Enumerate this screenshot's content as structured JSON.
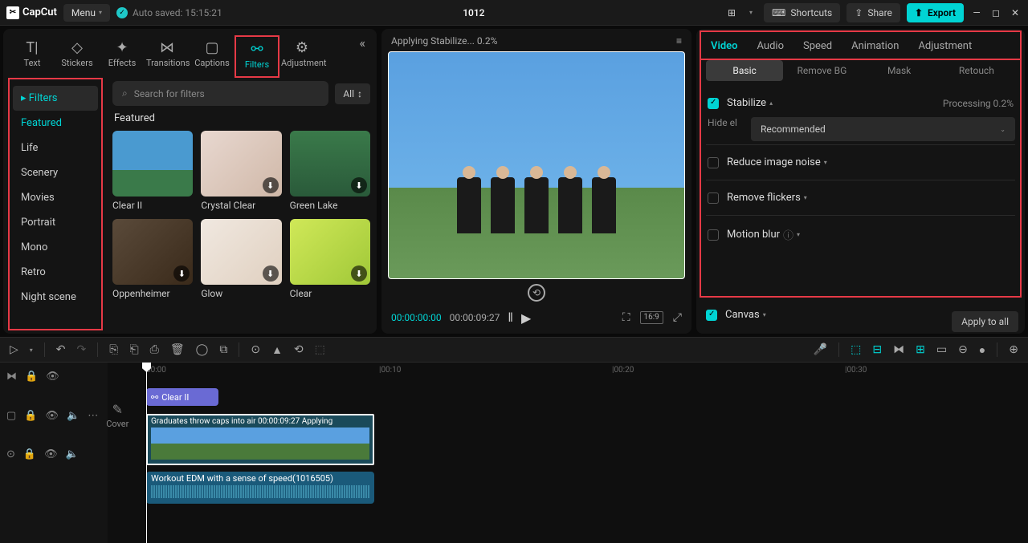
{
  "app": {
    "name": "CapCut",
    "menu": "Menu",
    "autosave": "Auto saved: 15:15:21",
    "project": "1012"
  },
  "topActions": {
    "shortcuts": "Shortcuts",
    "share": "Share",
    "export": "Export"
  },
  "toolTabs": [
    "Text",
    "Stickers",
    "Effects",
    "Transitions",
    "Captions",
    "Filters",
    "Adjustment"
  ],
  "toolIcons": [
    "T|",
    "◇",
    "✦",
    "⋈",
    "▢",
    "⚯",
    "⚙"
  ],
  "sidebar": {
    "header": "Filters",
    "items": [
      "Featured",
      "Life",
      "Scenery",
      "Movies",
      "Portrait",
      "Mono",
      "Retro",
      "Night scene"
    ],
    "active": 0
  },
  "search": {
    "placeholder": "Search for filters",
    "all": "All"
  },
  "grid": {
    "title": "Featured",
    "items": [
      {
        "label": "Clear II"
      },
      {
        "label": "Crystal Clear"
      },
      {
        "label": "Green Lake"
      },
      {
        "label": "Oppenheimer"
      },
      {
        "label": "Glow"
      },
      {
        "label": "Clear"
      }
    ]
  },
  "preview": {
    "status": "Applying Stabilize... 0.2%",
    "timeStart": "00:00:00:00",
    "timeEnd": "00:00:09:27",
    "ratio": "16:9"
  },
  "rightTabs": [
    "Video",
    "Audio",
    "Speed",
    "Animation",
    "Adjustment"
  ],
  "subTabs": [
    "Basic",
    "Remove BG",
    "Mask",
    "Retouch"
  ],
  "props": {
    "stabilize": "Stabilize",
    "stabilizeStatus": "Processing 0.2%",
    "hide": "Hide el",
    "recommended": "Recommended",
    "noise": "Reduce image noise",
    "flickers": "Remove flickers",
    "blur": "Motion blur",
    "canvas": "Canvas",
    "applyAll": "Apply to all"
  },
  "timeline": {
    "ruler": [
      "00:00",
      "|00:10",
      "|00:20",
      "|00:30"
    ],
    "filterClip": "Clear II",
    "videoClip": "Graduates throw caps into air   00:00:09:27   Applying",
    "audioClip": "Workout EDM with a sense of speed(1016505)",
    "cover": "Cover"
  }
}
